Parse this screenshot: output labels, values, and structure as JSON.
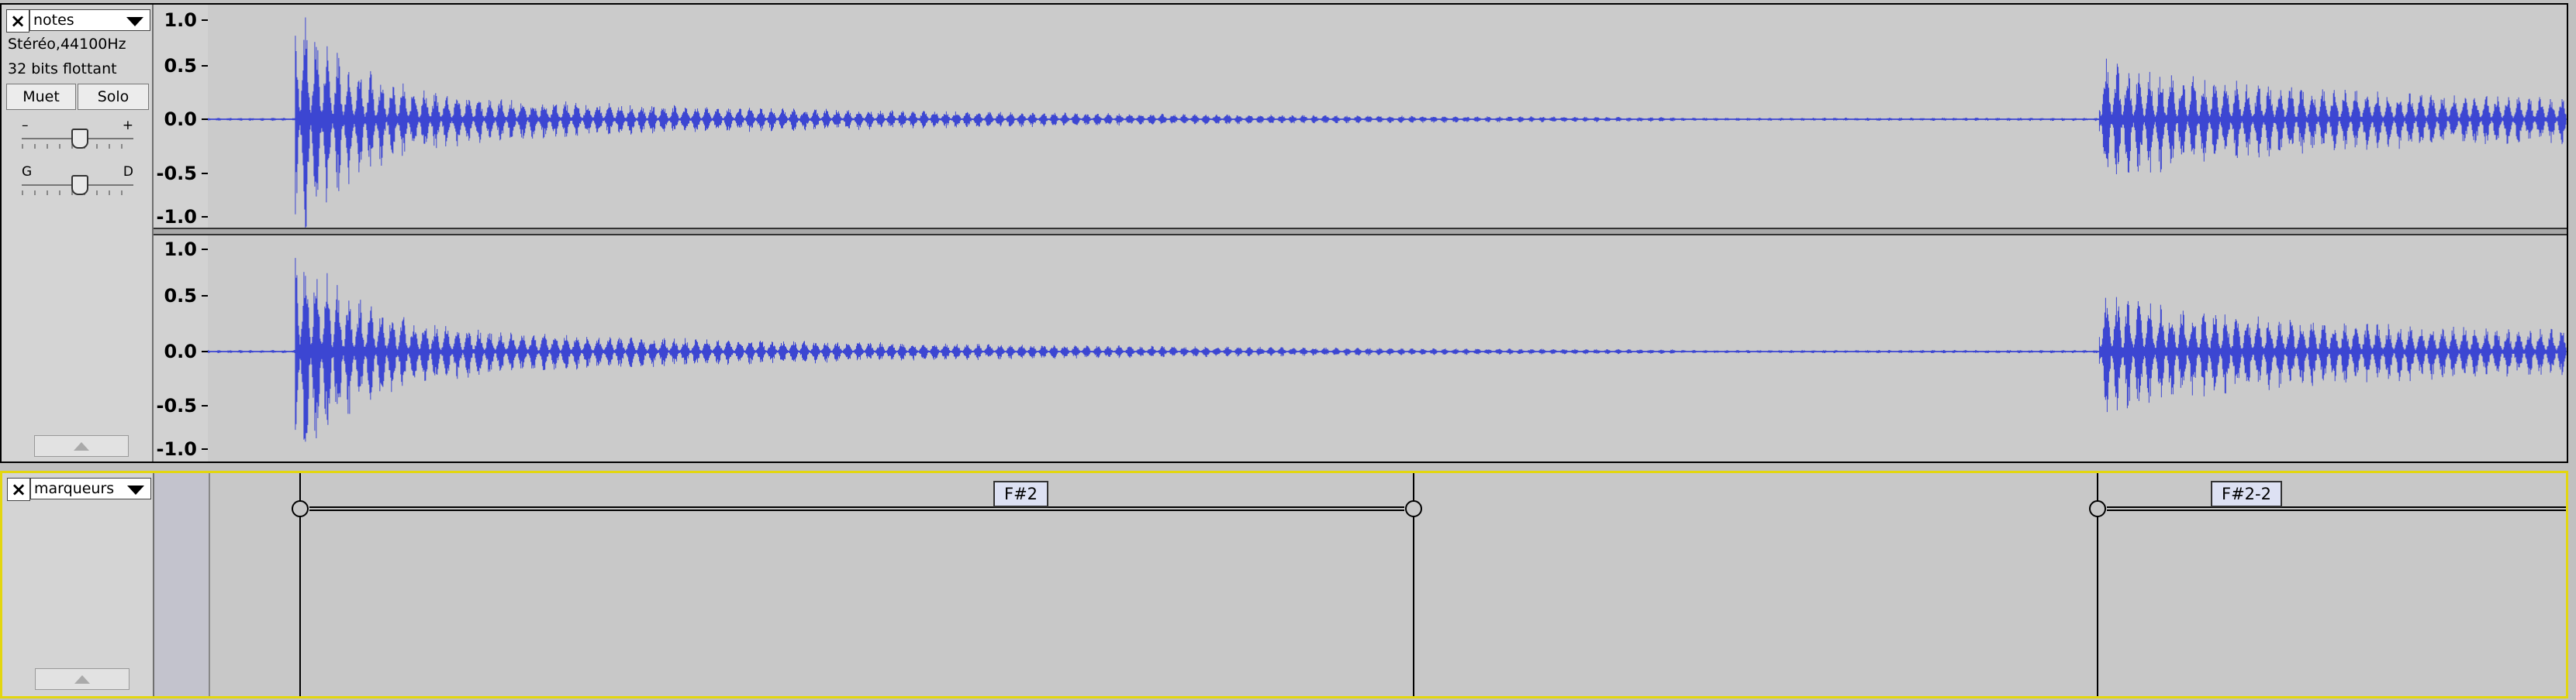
{
  "audio_track": {
    "close_glyph": "×",
    "name": "notes",
    "format": "Stéréo,44100Hz",
    "sample_format": "32 bits flottant",
    "mute_label": "Muet",
    "solo_label": "Solo",
    "gain_slider": {
      "min_label": "–",
      "max_label": "+",
      "value": 0.5
    },
    "pan_slider": {
      "min_label": "G",
      "max_label": "D",
      "value": 0.5
    },
    "channel_top": {
      "ticks": [
        "1.0",
        "0.5",
        "0.0",
        "-0.5",
        "-1.0"
      ]
    },
    "channel_bottom": {
      "ticks": [
        "1.0",
        "0.5",
        "0.0",
        "-0.5",
        "-1.0"
      ]
    },
    "waveform_color": "#3c46d2"
  },
  "label_track": {
    "close_glyph": "×",
    "name": "marqueurs",
    "accent_color": "#e3d60f",
    "labels": [
      {
        "text": "F#2"
      },
      {
        "text": "F#2-2"
      }
    ]
  }
}
